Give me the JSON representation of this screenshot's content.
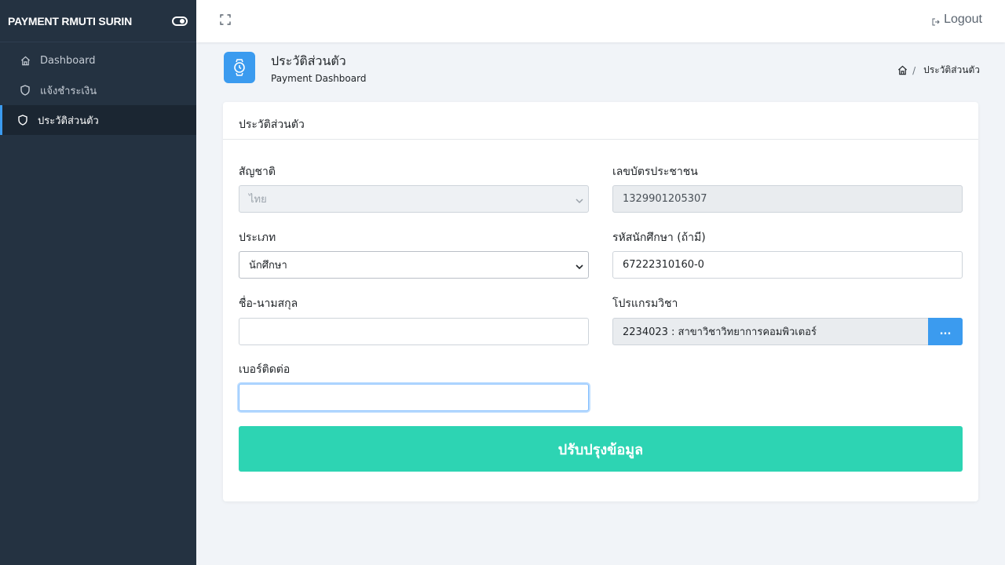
{
  "sidebar": {
    "brand": "PAYMENT RMUTI SURIN",
    "items": [
      {
        "label": "Dashboard",
        "icon": "home-icon"
      },
      {
        "label": "แจ้งชำระเงิน",
        "icon": "shield-icon"
      },
      {
        "label": "ประวัติส่วนตัว",
        "icon": "shield-icon",
        "active": true
      }
    ]
  },
  "topbar": {
    "logout_label": "Logout"
  },
  "header": {
    "title": "ประวัติส่วนตัว",
    "subtitle": "Payment Dashboard",
    "breadcrumb": "ประวัติส่วนตัว"
  },
  "card": {
    "title": "ประวัติส่วนตัว",
    "fields": {
      "nationality": {
        "label": "สัญชาติ",
        "value": "ไทย"
      },
      "id_card": {
        "label": "เลขบัตรประชาชน",
        "value": "1329901205307"
      },
      "type": {
        "label": "ประเภท",
        "value": "นักศึกษา"
      },
      "student_id": {
        "label": "รหัสนักศึกษา (ถ้ามี)",
        "value": "67222310160-0"
      },
      "fullname": {
        "label": "ชื่อ-นามสกุล",
        "value": ""
      },
      "program": {
        "label": "โปรแกรมวิชา",
        "value": "2234023 : สาขาวิชาวิทยาการคอมพิวเตอร์",
        "browse_label": "..."
      },
      "phone": {
        "label": "เบอร์ติดต่อ",
        "value": ""
      }
    },
    "submit_label": "ปรับปรุงข้อมูล"
  },
  "colors": {
    "sidebar_bg": "#243241",
    "accent": "#3b9bef",
    "submit": "#2dd4b3"
  }
}
